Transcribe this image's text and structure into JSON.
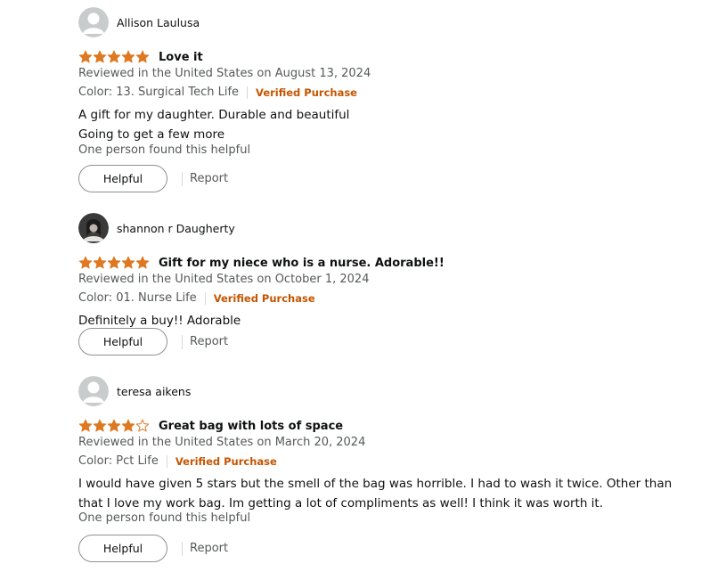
{
  "colors": {
    "star": "#de7921",
    "verified": "#c45500",
    "secondary_text": "#565959"
  },
  "reviews": [
    {
      "author": "Allison Laulusa",
      "avatar": "default-avatar-icon",
      "rating": 5,
      "title": "Love it",
      "date": "Reviewed in the United States on August 13, 2024",
      "variant": "Color: 13. Surgical Tech Life",
      "verified": "Verified Purchase",
      "body": [
        "A gift for my daughter. Durable and beautiful",
        "Going to get a few more"
      ],
      "helpful_count": "One person found this helpful",
      "helpful_label": "Helpful",
      "report_label": "Report"
    },
    {
      "author": "shannon r Daugherty",
      "avatar": "photo-avatar",
      "rating": 5,
      "title": "Gift for my niece who is a nurse. Adorable!!",
      "date": "Reviewed in the United States on October 1, 2024",
      "variant": "Color: 01. Nurse Life",
      "verified": "Verified Purchase",
      "body": [
        "Definitely a buy!! Adorable"
      ],
      "helpful_count": "",
      "helpful_label": "Helpful",
      "report_label": "Report"
    },
    {
      "author": "teresa aikens",
      "avatar": "default-avatar-icon",
      "rating": 4,
      "title": "Great bag with lots of space",
      "date": "Reviewed in the United States on March 20, 2024",
      "variant": "Color: Pct Life",
      "verified": "Verified Purchase",
      "body": [
        "I would have given 5 stars but the smell of the bag was horrible. I had to wash it twice. Other than that I love my work bag. Im getting a lot of compliments as well! I think it was worth it."
      ],
      "helpful_count": "One person found this helpful",
      "helpful_label": "Helpful",
      "report_label": "Report"
    }
  ]
}
